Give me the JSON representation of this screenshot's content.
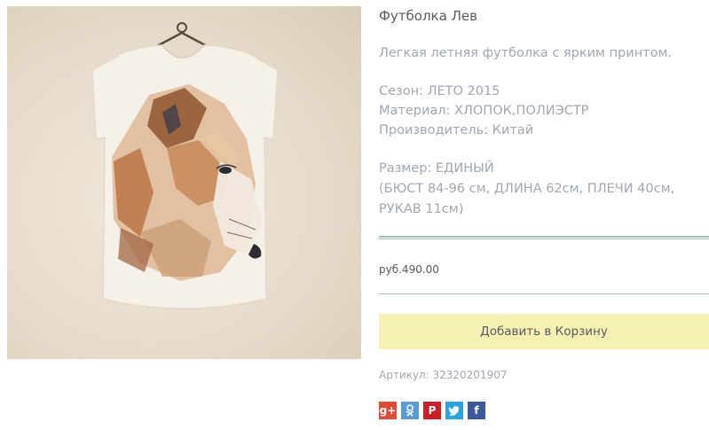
{
  "product": {
    "title": "Футболка Лев",
    "description": "Легкая летняя футболка с ярким принтом.",
    "specs": {
      "season": "Сезон: ЛЕТО 2015",
      "material": "Материал: ХЛОПОК,ПОЛИЭСТР",
      "manufacturer": "Производитель: Китай"
    },
    "size": {
      "line1": "Размер: ЕДИНЫЙ",
      "line2": "(БЮСТ 84-96 см, ДЛИНА 62см, ПЛЕЧИ 40см,",
      "line3": "РУКАВ 11см)"
    },
    "price": "руб.490.00",
    "add_to_cart_label": "Добавить в Корзину",
    "sku": "Артикул: 32320201907"
  },
  "share": [
    {
      "name": "google-plus-icon",
      "glyph": "g+",
      "color": "#dd4b39"
    },
    {
      "name": "odnoklassniki-icon",
      "glyph": "▮",
      "color": "#5b9bd5"
    },
    {
      "name": "pinterest-icon",
      "glyph": "P",
      "color": "#cb2027"
    },
    {
      "name": "twitter-icon",
      "glyph": "t",
      "color": "#2ba3e1"
    },
    {
      "name": "facebook-icon",
      "glyph": "f",
      "color": "#3b5998"
    }
  ],
  "colors": {
    "accent_rule": "#a8bfbb",
    "button_bg": "#f6f0b3",
    "muted_text": "#9fa7b3",
    "body_text": "#555b5f"
  }
}
